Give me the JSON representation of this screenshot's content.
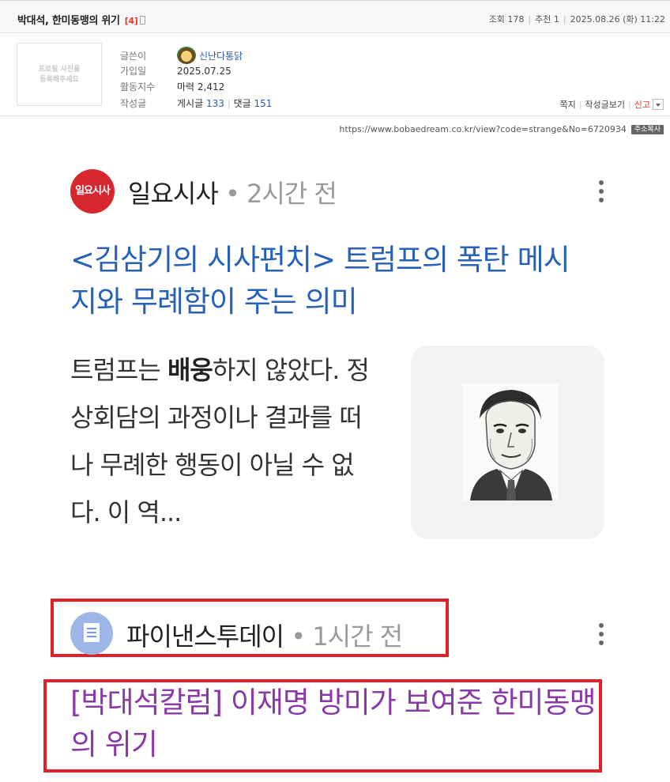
{
  "post": {
    "title": "박대석, 한미동맹의 위기",
    "comment_count": "[4]",
    "views_label": "조회 178",
    "recommend_label": "추천 1",
    "datetime": "2025.08.26 (화) 11:22"
  },
  "author": {
    "photo_placeholder_line1": "프로필 사진을",
    "photo_placeholder_line2": "등록해주세요",
    "writer_label": "글쓴이",
    "nickname": "신난다통닭",
    "joined_label": "가입일",
    "joined_value": "2025.07.25",
    "activity_label": "활동지수",
    "activity_value": "마력 2,412",
    "posts_label": "작성글",
    "posts_text": "게시글",
    "posts_count": "133",
    "comments_text": "댓글",
    "comments_count": "151"
  },
  "actions": {
    "message": "쪽지",
    "view_posts": "작성글보기",
    "report": "신고"
  },
  "url": {
    "text": "https://www.bobaedream.co.kr/view?code=strange&No=6720934",
    "copy_button": "주소복사"
  },
  "article1": {
    "source_logo_text": "일요시사",
    "source": "일요시사",
    "time": "• 2시간 전",
    "headline": "<김삼기의 시사펀치> 트럼프의 폭탄 메시지와 무례함이 주는 의미",
    "summary_pre": "트럼프는 ",
    "summary_bold": "배웅",
    "summary_post": "하지 않았다. 정상회담의 과정이나 결과를 떠나 무례한 행동이 아닐 수 없다. 이 역..."
  },
  "article2": {
    "source": "파이낸스투데이",
    "time": "• 1시간 전",
    "headline": "[박대석칼럼] 이재명 방미가 보여준 한미동맹의 위기"
  },
  "colors": {
    "headline1": "#2762b8",
    "headline2_visited": "#8a3aa6",
    "highlight_box": "#e3202a",
    "source1_logo": "#d7282f",
    "source2_logo": "#9cb6e8"
  }
}
